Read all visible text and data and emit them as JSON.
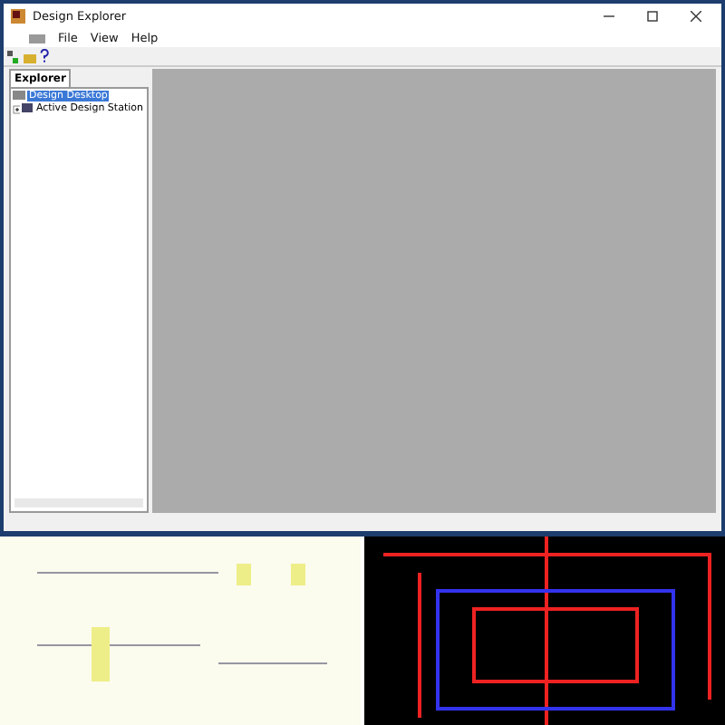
{
  "window": {
    "title": "Design Explorer"
  },
  "menu": [
    "File",
    "View",
    "Help"
  ],
  "panel_tabs": [
    {
      "label": "Explorer",
      "selected": true
    }
  ],
  "tree": [
    {
      "label": "Design Desktop",
      "selected": true,
      "leaf": true
    },
    {
      "label": "Active Design Station",
      "selected": false,
      "expanded": false
    }
  ]
}
